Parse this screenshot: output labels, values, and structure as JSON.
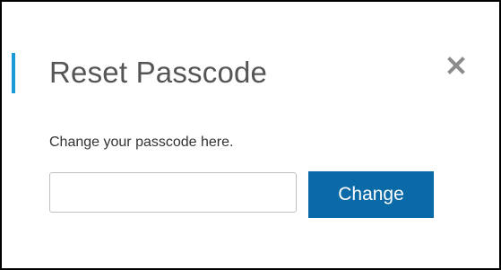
{
  "dialog": {
    "title": "Reset Passcode",
    "close_icon": "close-icon",
    "description": "Change your passcode here.",
    "passcode_input": {
      "value": "",
      "placeholder": ""
    },
    "change_button_label": "Change"
  },
  "colors": {
    "accent": "#1a9bd7",
    "button_background": "#0a6aa8",
    "button_text": "#ffffff",
    "title_text": "#555555",
    "close_icon": "#8c8c8c"
  }
}
